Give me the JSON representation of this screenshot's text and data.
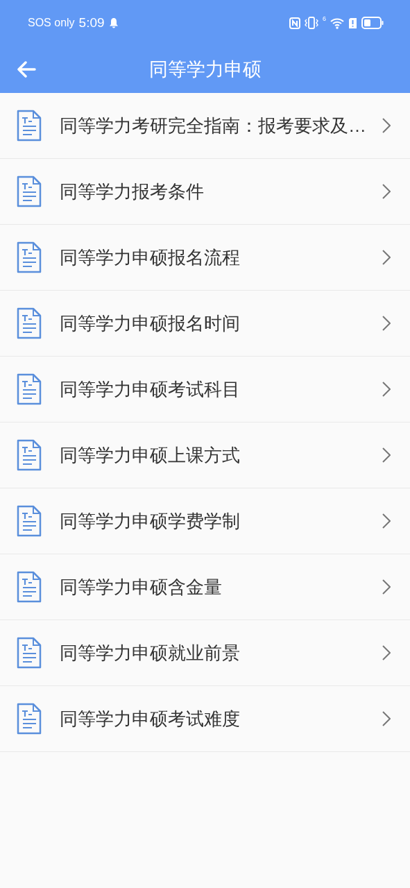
{
  "status_bar": {
    "carrier": "SOS only",
    "time": "5:09",
    "signal_label": "6"
  },
  "header": {
    "title": "同等学力申硕"
  },
  "items": [
    {
      "label": "同等学力考研完全指南：报考要求及…"
    },
    {
      "label": "同等学力报考条件"
    },
    {
      "label": "同等学力申硕报名流程"
    },
    {
      "label": "同等学力申硕报名时间"
    },
    {
      "label": "同等学力申硕考试科目"
    },
    {
      "label": "同等学力申硕上课方式"
    },
    {
      "label": "同等学力申硕学费学制"
    },
    {
      "label": "同等学力申硕含金量"
    },
    {
      "label": "同等学力申硕就业前景"
    },
    {
      "label": "同等学力申硕考试难度"
    }
  ]
}
